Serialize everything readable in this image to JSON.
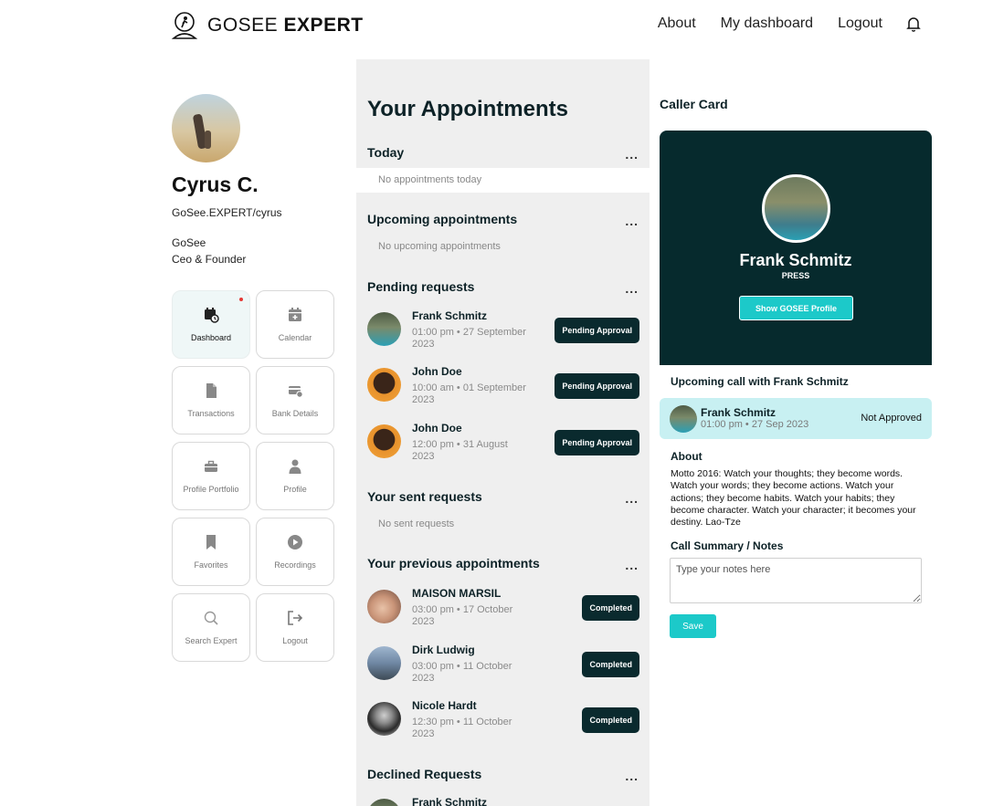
{
  "header": {
    "brand_light": "GOSEE",
    "brand_bold": "EXPERT",
    "nav": [
      "About",
      "My dashboard",
      "Logout"
    ]
  },
  "profile": {
    "name": "Cyrus C.",
    "url": "GoSee.EXPERT/cyrus",
    "company": "GoSee",
    "role": "Ceo & Founder"
  },
  "menu": [
    {
      "label": "Dashboard",
      "icon": "calendar-clock-icon",
      "active": true,
      "notify": true
    },
    {
      "label": "Calendar",
      "icon": "calendar-add-icon",
      "active": false
    },
    {
      "label": "Transactions",
      "icon": "document-icon",
      "active": false
    },
    {
      "label": "Bank Details",
      "icon": "bank-card-icon",
      "active": false
    },
    {
      "label": "Profile Portfolio",
      "icon": "briefcase-icon",
      "active": false
    },
    {
      "label": "Profile",
      "icon": "user-icon",
      "active": false
    },
    {
      "label": "Favorites",
      "icon": "bookmark-icon",
      "active": false
    },
    {
      "label": "Recordings",
      "icon": "play-circle-icon",
      "active": false
    },
    {
      "label": "Search Expert",
      "icon": "search-icon",
      "active": false
    },
    {
      "label": "Logout",
      "icon": "logout-icon",
      "active": false
    }
  ],
  "appointments": {
    "title": "Your Appointments",
    "more": "...",
    "today": {
      "title": "Today",
      "empty": "No appointments today"
    },
    "upcoming": {
      "title": "Upcoming appointments",
      "empty": "No upcoming appointments"
    },
    "pending": {
      "title": "Pending requests",
      "items": [
        {
          "name": "Frank Schmitz",
          "time": "01:00 pm • 27 September 2023",
          "status": "Pending Approval"
        },
        {
          "name": "John Doe",
          "time": "10:00 am • 01 September 2023",
          "status": "Pending Approval"
        },
        {
          "name": "John Doe",
          "time": "12:00 pm • 31 August 2023",
          "status": "Pending Approval"
        }
      ]
    },
    "sent": {
      "title": "Your sent requests",
      "empty": "No sent requests"
    },
    "previous": {
      "title": "Your previous appointments",
      "items": [
        {
          "name": "MAISON MARSIL",
          "time": "03:00 pm • 17 October 2023",
          "status": "Completed"
        },
        {
          "name": "Dirk Ludwig",
          "time": "03:00 pm • 11 October 2023",
          "status": "Completed"
        },
        {
          "name": "Nicole Hardt",
          "time": "12:30 pm • 11 October 2023",
          "status": "Completed"
        }
      ]
    },
    "declined": {
      "title": "Declined Requests",
      "items": [
        {
          "name": "Frank Schmitz"
        }
      ]
    }
  },
  "caller_card": {
    "title": "Caller Card",
    "name": "Frank Schmitz",
    "role": "PRESS",
    "profile_button": "Show GOSEE Profile",
    "upcoming_title": "Upcoming call with Frank Schmitz",
    "upcoming": {
      "name": "Frank Schmitz",
      "time": "01:00 pm • 27 Sep 2023",
      "status": "Not Approved"
    },
    "about_title": "About",
    "about_text": "Motto 2016: Watch your thoughts; they become words. Watch your words; they become actions. Watch your actions; they become habits. Watch your habits; they become character. Watch your character; it becomes your destiny. Lao-Tze",
    "notes_title": "Call Summary / Notes",
    "notes_placeholder": "Type your notes here",
    "save_label": "Save"
  },
  "colors": {
    "dark_teal": "#062a2d",
    "accent_cyan": "#1cc9c9",
    "light_cyan": "#c8f0f2",
    "panel_gray": "#efefef"
  }
}
